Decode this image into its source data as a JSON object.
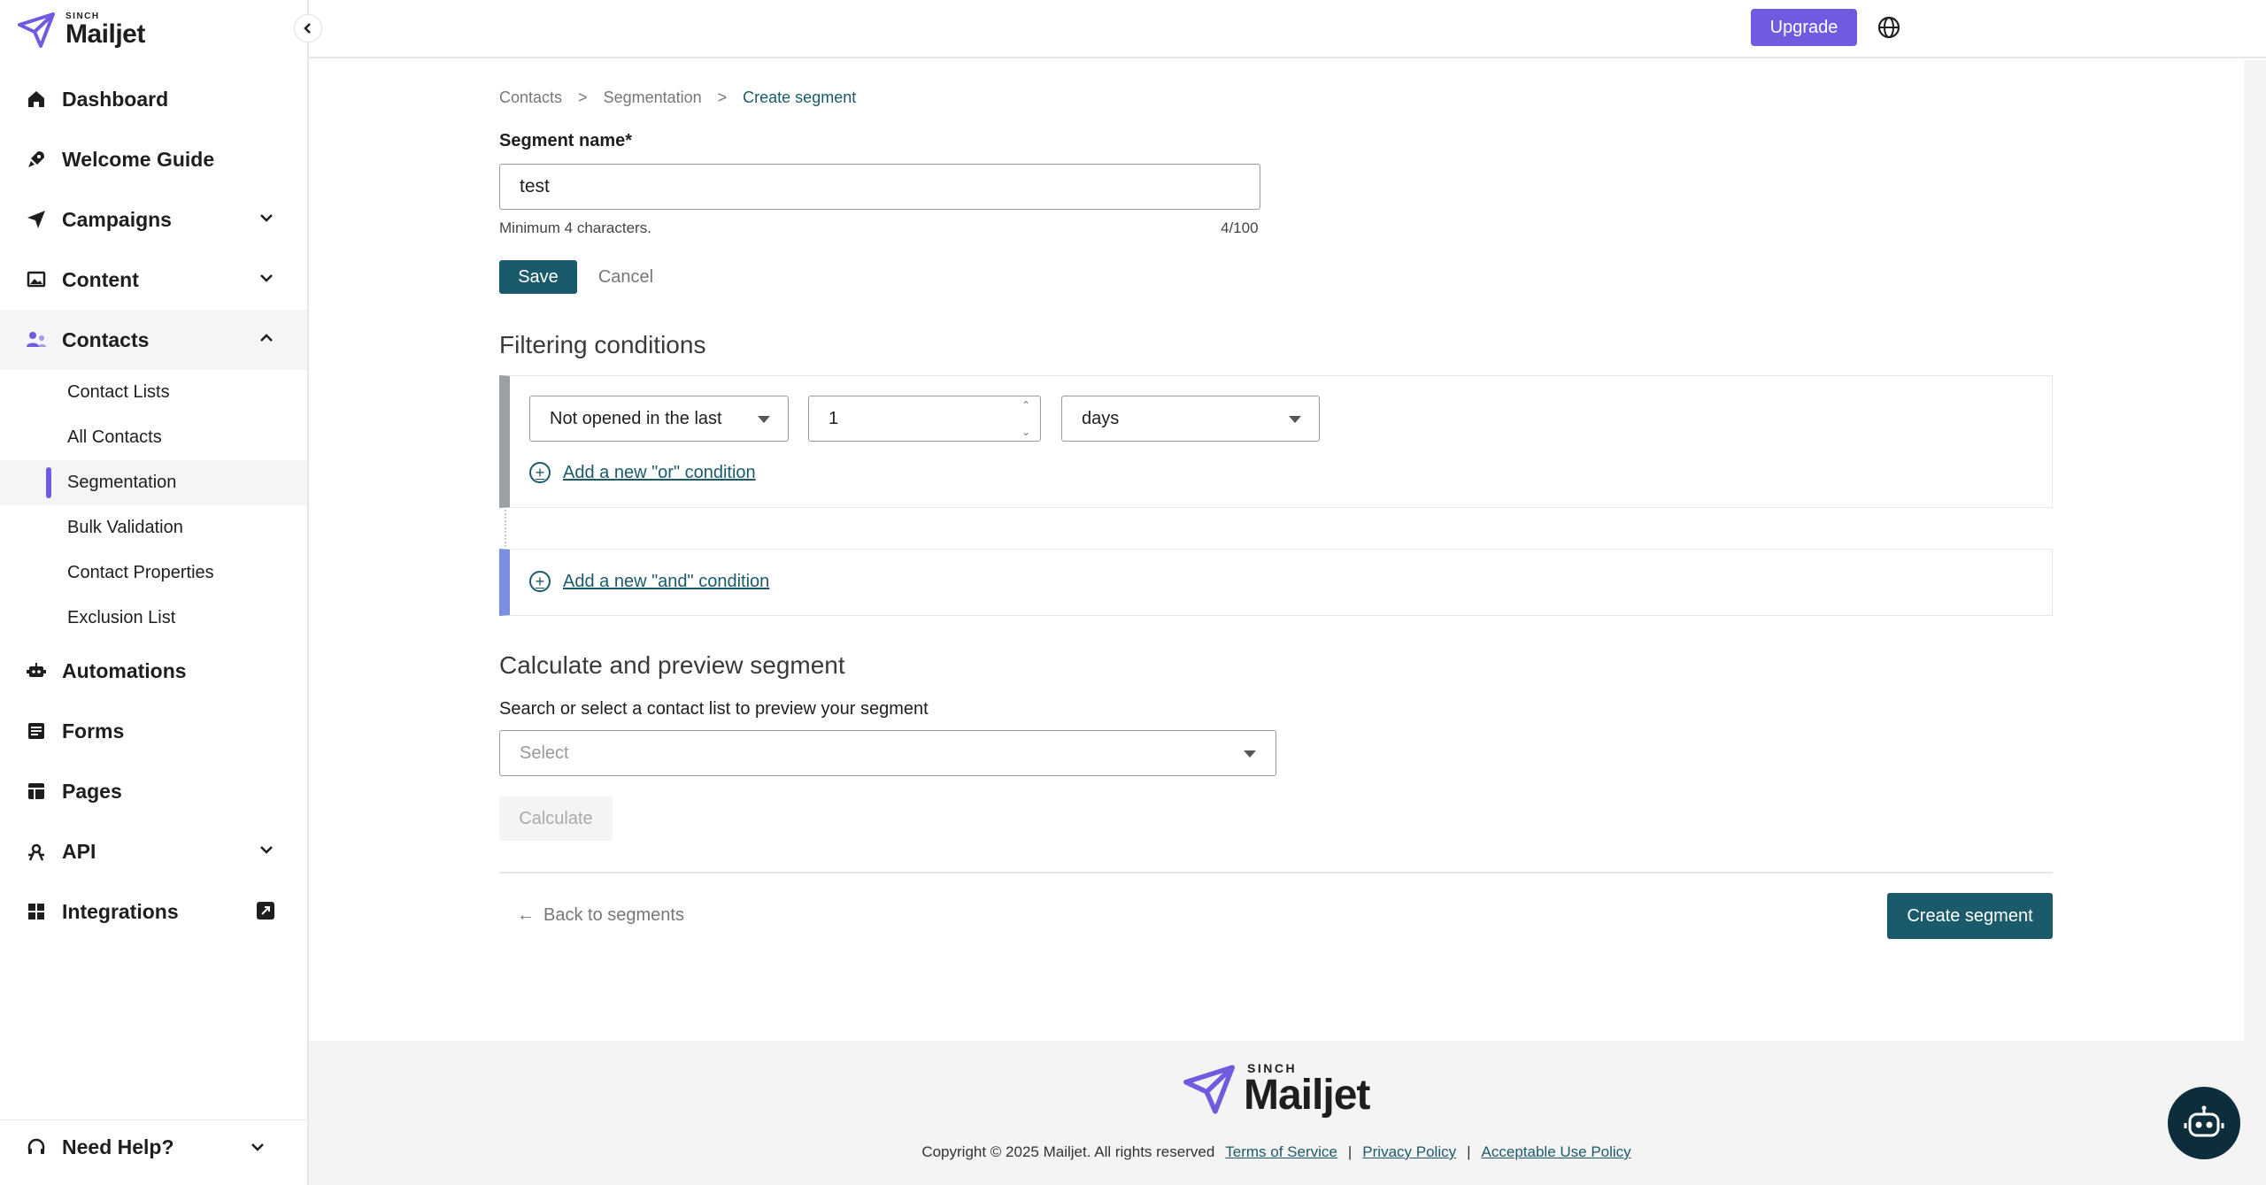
{
  "brand": {
    "sinch": "SINCH",
    "mailjet": "Mailjet"
  },
  "sidebar": {
    "items": [
      {
        "label": "Dashboard"
      },
      {
        "label": "Welcome Guide"
      },
      {
        "label": "Campaigns"
      },
      {
        "label": "Content"
      },
      {
        "label": "Contacts"
      },
      {
        "label": "Automations"
      },
      {
        "label": "Forms"
      },
      {
        "label": "Pages"
      },
      {
        "label": "API"
      },
      {
        "label": "Integrations"
      }
    ],
    "contacts_sub": [
      {
        "label": "Contact Lists"
      },
      {
        "label": "All Contacts"
      },
      {
        "label": "Segmentation"
      },
      {
        "label": "Bulk Validation"
      },
      {
        "label": "Contact Properties"
      },
      {
        "label": "Exclusion List"
      }
    ],
    "need_help": "Need Help?"
  },
  "topbar": {
    "upgrade_label": "Upgrade"
  },
  "breadcrumb": {
    "items": [
      "Contacts",
      "Segmentation",
      "Create segment"
    ],
    "sep": ">"
  },
  "segment": {
    "name_label": "Segment name*",
    "name_value": "test",
    "hint": "Minimum 4 characters.",
    "counter": "4/100",
    "save_label": "Save",
    "cancel_label": "Cancel"
  },
  "filtering": {
    "title": "Filtering conditions",
    "condition_type": "Not opened in the last",
    "condition_value": "1",
    "condition_unit": "days",
    "add_or": "Add a new \"or\" condition",
    "add_and": "Add a new \"and\" condition"
  },
  "preview": {
    "title": "Calculate and preview segment",
    "label": "Search or select a contact list to preview your segment",
    "select_placeholder": "Select",
    "calculate_label": "Calculate"
  },
  "actions": {
    "back_label": "Back to segments",
    "create_label": "Create segment"
  },
  "footer": {
    "copyright": "Copyright © 2025 Mailjet. All rights reserved",
    "links": [
      "Terms of Service",
      "Privacy Policy",
      "Acceptable Use Policy"
    ],
    "sep": "|"
  },
  "colors": {
    "accent": "#6e5be0",
    "primary": "#1b5a6b"
  }
}
